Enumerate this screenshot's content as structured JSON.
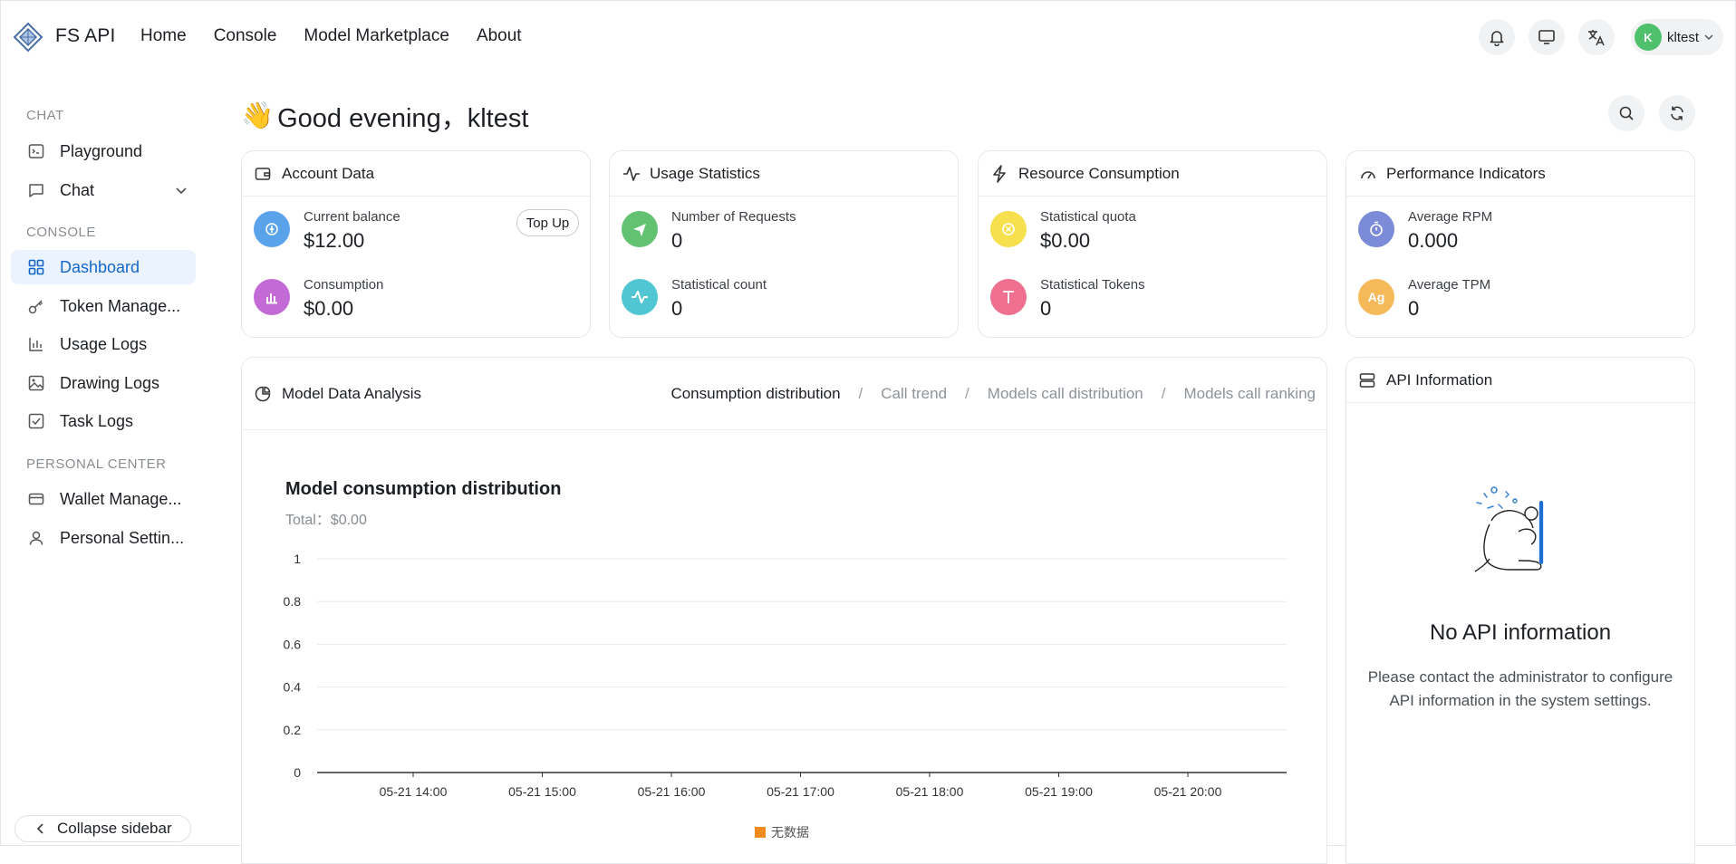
{
  "brand": {
    "name": "FS API"
  },
  "nav": {
    "home": "Home",
    "console": "Console",
    "marketplace": "Model Marketplace",
    "about": "About"
  },
  "user": {
    "initial": "K",
    "name": "kltest",
    "avatar_color": "#4fc16d"
  },
  "sidebar": {
    "section_chat": "CHAT",
    "playground": "Playground",
    "chat": "Chat",
    "section_console": "CONSOLE",
    "dashboard": "Dashboard",
    "token": "Token Manage...",
    "usage_logs": "Usage Logs",
    "drawing_logs": "Drawing Logs",
    "task_logs": "Task Logs",
    "section_personal": "PERSONAL CENTER",
    "wallet": "Wallet Manage...",
    "personal": "Personal Settin...",
    "collapse": "Collapse sidebar"
  },
  "greeting": {
    "emoji": "👋",
    "text": "Good evening，kltest"
  },
  "account": {
    "title": "Account Data",
    "balance_label": "Current balance",
    "balance_value": "$12.00",
    "topup": "Top Up",
    "consumption_label": "Consumption",
    "consumption_value": "$0.00"
  },
  "usage": {
    "title": "Usage Statistics",
    "requests_label": "Number of Requests",
    "requests_value": "0",
    "count_label": "Statistical count",
    "count_value": "0"
  },
  "resource": {
    "title": "Resource Consumption",
    "quota_label": "Statistical quota",
    "quota_value": "$0.00",
    "tokens_label": "Statistical Tokens",
    "tokens_value": "0"
  },
  "performance": {
    "title": "Performance Indicators",
    "rpm_label": "Average RPM",
    "rpm_value": "0.000",
    "tpm_label": "Average TPM",
    "tpm_value": "0",
    "tpm_icon_text": "Ag"
  },
  "analysis": {
    "title": "Model Data Analysis",
    "tabs": [
      "Consumption distribution",
      "Call trend",
      "Models call distribution",
      "Models call ranking"
    ],
    "separator": "/",
    "chart_title": "Model consumption distribution",
    "chart_total": "Total：$0.00"
  },
  "api": {
    "title": "API Information",
    "empty_title": "No API information",
    "empty_desc": "Please contact the administrator to configure API information in the system settings."
  },
  "colors": {
    "accent": "#1567c9",
    "blue": "#5aa3ea",
    "purple": "#c36ad6",
    "green": "#62c271",
    "cyan": "#4fc6d1",
    "yellow": "#f7e04e",
    "pink": "#ee6f8e",
    "indigo": "#7c8bd8",
    "orange": "#f5b95a"
  },
  "chart_data": {
    "type": "bar",
    "categories": [
      "05-21 14:00",
      "05-21 15:00",
      "05-21 16:00",
      "05-21 17:00",
      "05-21 18:00",
      "05-21 19:00",
      "05-21 20:00"
    ],
    "series": [
      {
        "name": "无数据",
        "values": [
          0,
          0,
          0,
          0,
          0,
          0,
          0
        ],
        "color": "#f08a1c"
      }
    ],
    "yticks": [
      "0",
      "0.2",
      "0.4",
      "0.6",
      "0.8",
      "1"
    ],
    "ylim": [
      0,
      1
    ],
    "grid": true,
    "legend": "bottom"
  }
}
